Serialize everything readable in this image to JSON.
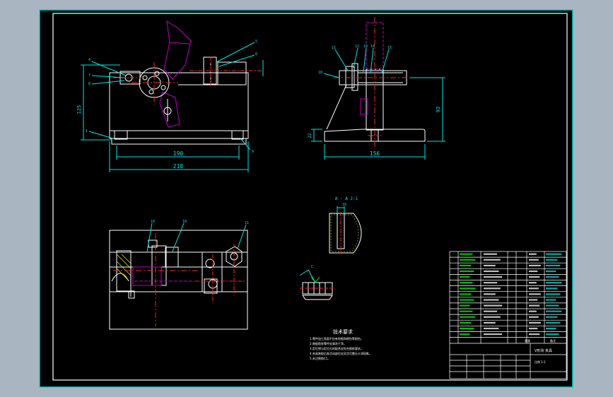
{
  "dims": {
    "front_width_inner": "190",
    "front_width_outer": "218",
    "front_height": "125",
    "side_base_width": "156",
    "side_height": "93",
    "side_base_height": "22",
    "detail_dim": "16"
  },
  "detail_label": "A - A 2:1",
  "balloons": {
    "front": [
      "4",
      "7",
      "8",
      "9",
      "1",
      "5",
      "6",
      "9"
    ],
    "side": [
      "11",
      "12",
      "13",
      "14",
      "15",
      "10"
    ],
    "plan": [
      "10",
      "18",
      "11"
    ],
    "small": [
      "C"
    ]
  },
  "tech_title": "技术要求",
  "tech_notes": [
    "1.零件加工表面不应有划痕和擦伤等损伤。",
    "2.装配前各零件应清洗干净。",
    "3.定位销与定位孔的配合应符合图纸要求。",
    "4.夹具装配后各活动部位应灵活可靠无卡滞现象。",
    "5.未注倒角C1。"
  ],
  "title_block": {
    "drawing_name": "V形块 夹具",
    "scale": "比例 1:1",
    "weight_label": "重量",
    "remark_label": "备注"
  },
  "colors": {
    "background": "#000000",
    "frame": "#ffffff",
    "part": "#ffffff",
    "dimension": "#00e5e5",
    "handle": "#c000c0",
    "centerline": "#ff2020",
    "accent": "#ffff00",
    "green": "#00ff00"
  }
}
